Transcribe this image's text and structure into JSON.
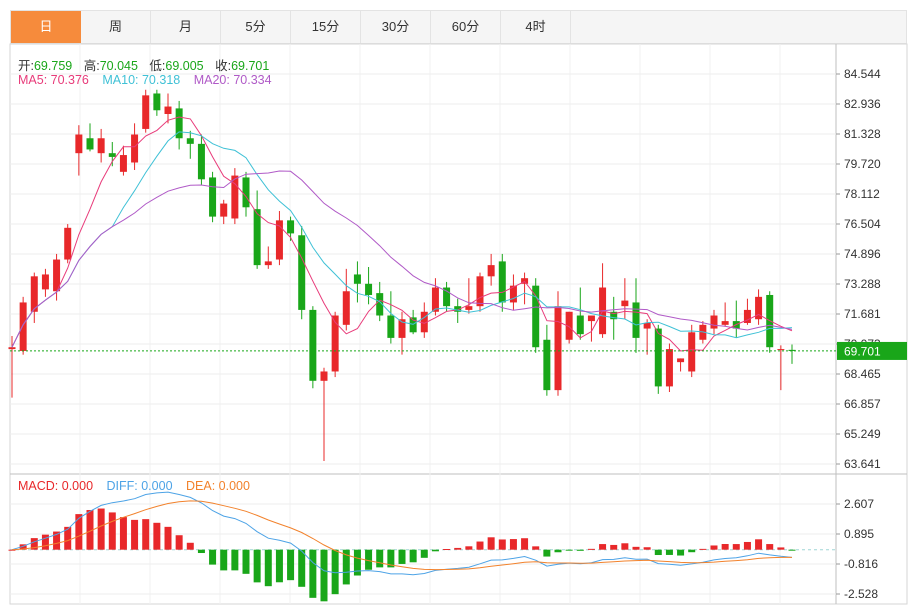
{
  "tabs": [
    {
      "label": "日",
      "active": true
    },
    {
      "label": "周",
      "active": false
    },
    {
      "label": "月",
      "active": false
    },
    {
      "label": "5分",
      "active": false
    },
    {
      "label": "15分",
      "active": false
    },
    {
      "label": "30分",
      "active": false
    },
    {
      "label": "60分",
      "active": false
    },
    {
      "label": "4时",
      "active": false
    }
  ],
  "ohlc_info": {
    "open_label": "开:",
    "open_value": "69.759",
    "high_label": "高:",
    "high_value": "70.045",
    "low_label": "低:",
    "low_value": "69.005",
    "close_label": "收:",
    "close_value": "69.701"
  },
  "ma_info": {
    "ma5_label": "MA5: ",
    "ma5_value": "70.376",
    "ma10_label": "MA10: ",
    "ma10_value": "70.318",
    "ma20_label": "MA20: ",
    "ma20_value": "70.334"
  },
  "macd_info": {
    "macd_label": "MACD: ",
    "macd_value": "0.000",
    "diff_label": "DIFF: ",
    "diff_value": "0.000",
    "dea_label": "DEA: ",
    "dea_value": "0.000"
  },
  "colors": {
    "up": "#e8282a",
    "down": "#19a619",
    "ma5": "#e83b7a",
    "ma10": "#3fc1d6",
    "ma20": "#b05ac7",
    "dea": "#f2822c",
    "diff": "#4da3e6",
    "price_tag": "#19a619"
  },
  "chart_data": {
    "type": "candlestick",
    "price_axis": {
      "ticks": [
        "84.544",
        "82.936",
        "81.328",
        "79.720",
        "78.112",
        "76.504",
        "74.896",
        "73.288",
        "71.681",
        "70.073",
        "68.465",
        "66.857",
        "65.249",
        "63.641"
      ],
      "range": [
        63.641,
        84.544
      ],
      "current_price": "69.701"
    },
    "macd_axis": {
      "ticks": [
        "2.607",
        "0.895",
        "-0.816",
        "-2.528"
      ],
      "range": [
        -2.528,
        2.607
      ]
    },
    "candles": [
      [
        69.8,
        70.5,
        67.2,
        69.9
      ],
      [
        69.7,
        72.6,
        69.5,
        72.3
      ],
      [
        71.8,
        73.9,
        71.2,
        73.7
      ],
      [
        73.0,
        74.1,
        72.6,
        73.8
      ],
      [
        72.9,
        74.9,
        72.4,
        74.6
      ],
      [
        74.6,
        76.5,
        74.4,
        76.3
      ],
      [
        80.3,
        81.8,
        79.1,
        81.3
      ],
      [
        81.1,
        81.9,
        80.4,
        80.5
      ],
      [
        80.3,
        81.6,
        79.8,
        81.1
      ],
      [
        80.3,
        80.9,
        79.6,
        80.1
      ],
      [
        79.3,
        80.7,
        79.1,
        80.2
      ],
      [
        79.8,
        81.9,
        79.4,
        81.3
      ],
      [
        81.6,
        83.7,
        81.4,
        83.4
      ],
      [
        83.5,
        83.7,
        82.3,
        82.6
      ],
      [
        82.4,
        83.5,
        81.9,
        82.8
      ],
      [
        82.7,
        83.1,
        80.5,
        81.1
      ],
      [
        81.1,
        81.5,
        80.0,
        80.8
      ],
      [
        80.8,
        81.3,
        78.6,
        78.9
      ],
      [
        79.0,
        79.3,
        76.6,
        76.9
      ],
      [
        76.9,
        77.8,
        76.5,
        77.6
      ],
      [
        76.8,
        79.5,
        76.5,
        79.1
      ],
      [
        79.0,
        79.3,
        76.9,
        77.4
      ],
      [
        77.3,
        78.3,
        74.1,
        74.3
      ],
      [
        74.3,
        75.3,
        74.1,
        74.5
      ],
      [
        74.6,
        77.2,
        74.3,
        76.7
      ],
      [
        76.7,
        76.9,
        75.6,
        76.0
      ],
      [
        75.9,
        76.4,
        71.4,
        71.9
      ],
      [
        71.9,
        72.1,
        67.7,
        68.1
      ],
      [
        68.1,
        68.8,
        63.8,
        68.6
      ],
      [
        68.6,
        71.8,
        68.3,
        71.6
      ],
      [
        71.1,
        74.1,
        70.8,
        72.9
      ],
      [
        73.8,
        74.5,
        72.3,
        73.3
      ],
      [
        73.3,
        74.2,
        72.2,
        72.7
      ],
      [
        72.8,
        73.4,
        71.3,
        71.6
      ],
      [
        71.6,
        72.9,
        70.1,
        70.4
      ],
      [
        70.4,
        71.8,
        69.5,
        71.4
      ],
      [
        71.5,
        71.9,
        70.6,
        70.7
      ],
      [
        70.7,
        72.3,
        70.4,
        71.8
      ],
      [
        71.8,
        73.6,
        71.6,
        73.1
      ],
      [
        73.1,
        73.4,
        71.8,
        72.1
      ],
      [
        72.1,
        72.5,
        71.2,
        71.8
      ],
      [
        71.9,
        73.6,
        71.7,
        72.1
      ],
      [
        72.1,
        73.9,
        71.8,
        73.7
      ],
      [
        73.7,
        74.9,
        73.2,
        74.3
      ],
      [
        74.5,
        74.9,
        71.8,
        72.3
      ],
      [
        72.3,
        73.8,
        71.9,
        73.2
      ],
      [
        73.3,
        73.9,
        72.2,
        73.6
      ],
      [
        73.2,
        73.6,
        69.6,
        69.9
      ],
      [
        70.3,
        71.1,
        67.3,
        67.6
      ],
      [
        67.6,
        72.9,
        67.3,
        72.1
      ],
      [
        70.3,
        71.8,
        70.1,
        71.8
      ],
      [
        71.6,
        73.1,
        70.3,
        70.6
      ],
      [
        71.3,
        71.6,
        70.2,
        71.6
      ],
      [
        70.6,
        74.4,
        70.4,
        73.1
      ],
      [
        71.8,
        72.6,
        70.3,
        71.4
      ],
      [
        72.1,
        73.6,
        71.4,
        72.4
      ],
      [
        72.3,
        73.6,
        69.6,
        70.4
      ],
      [
        70.9,
        71.4,
        69.5,
        71.2
      ],
      [
        70.9,
        71.1,
        67.4,
        67.8
      ],
      [
        67.8,
        70.1,
        67.5,
        69.8
      ],
      [
        69.1,
        69.3,
        68.6,
        69.3
      ],
      [
        68.6,
        71.1,
        68.3,
        70.7
      ],
      [
        70.3,
        71.3,
        70.1,
        71.1
      ],
      [
        70.9,
        71.9,
        70.6,
        71.6
      ],
      [
        71.1,
        72.3,
        71.0,
        71.3
      ],
      [
        71.3,
        72.4,
        70.4,
        70.9
      ],
      [
        71.2,
        72.5,
        71.1,
        71.9
      ],
      [
        71.4,
        73.0,
        71.1,
        72.6
      ],
      [
        72.7,
        72.9,
        69.6,
        69.9
      ],
      [
        69.8,
        70.0,
        67.6,
        69.8
      ],
      [
        69.759,
        70.045,
        69.005,
        69.701
      ]
    ]
  }
}
